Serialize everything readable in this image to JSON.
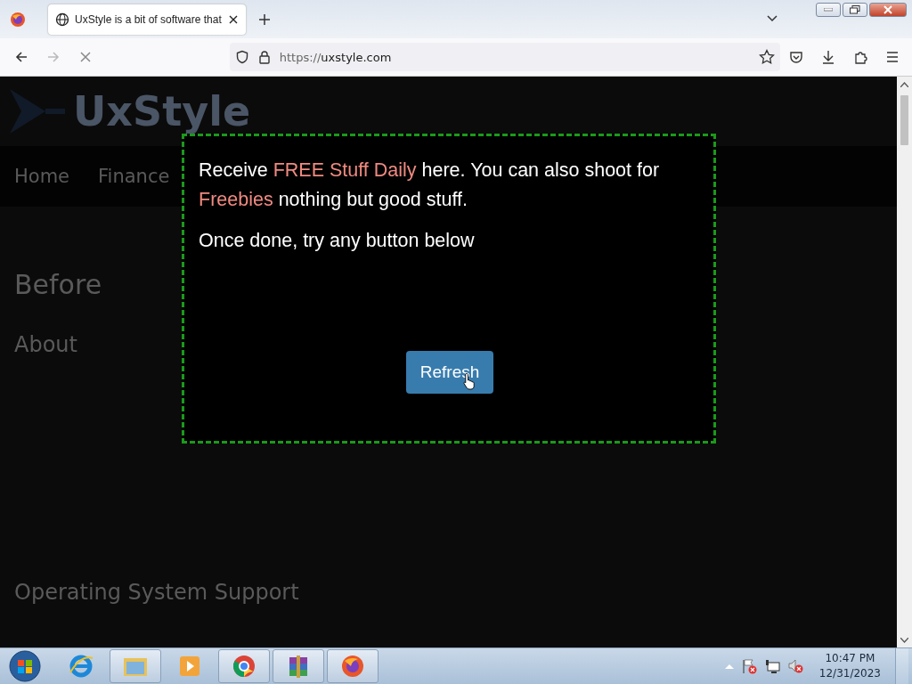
{
  "browser": {
    "tab_title": "UxStyle is a bit of software that",
    "url_scheme": "https://",
    "url_host": "uxstyle.com"
  },
  "page": {
    "logo": "UxStyle",
    "nav": [
      "Home",
      "Finance"
    ],
    "headings": [
      {
        "text": "Before",
        "kind": "h1"
      },
      {
        "text": "About",
        "kind": "h2"
      },
      {
        "text": "Operating System Support",
        "kind": "h2"
      }
    ]
  },
  "modal": {
    "paragraphs": [
      [
        {
          "text": "Receive ",
          "kind": "plain"
        },
        {
          "text": "FREE Stuff Daily",
          "kind": "highlight"
        },
        {
          "text": " here. You can also shoot for ",
          "kind": "plain"
        },
        {
          "text": "Freebies",
          "kind": "highlight"
        },
        {
          "text": " nothing but good stuff.",
          "kind": "plain"
        }
      ],
      [
        {
          "text": "Once done, try any button below",
          "kind": "plain"
        }
      ]
    ],
    "button": "Refresh"
  },
  "taskbar": {
    "time": "10:47 PM",
    "date": "12/31/2023"
  }
}
